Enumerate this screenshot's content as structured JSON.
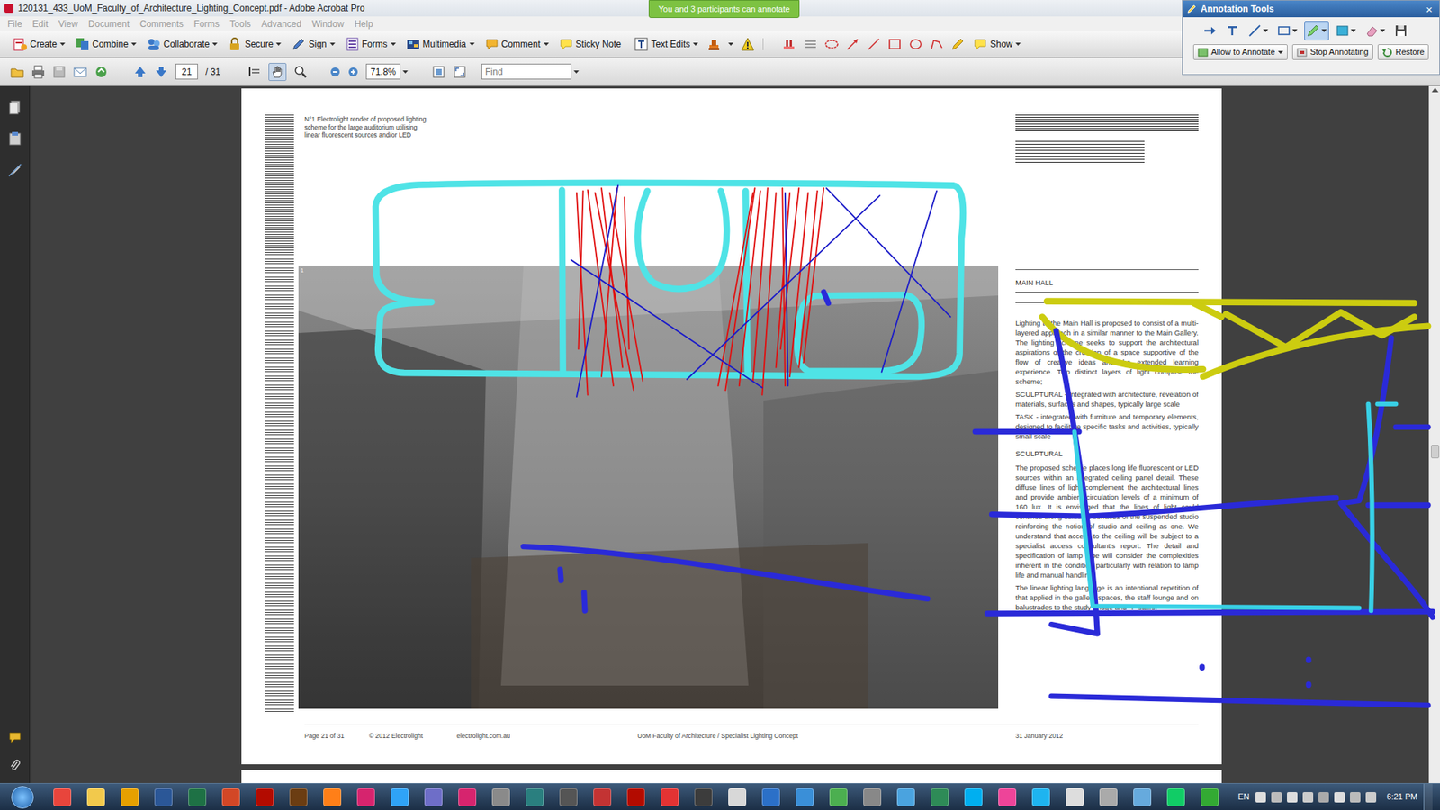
{
  "window": {
    "title": "120131_433_UoM_Faculty_of_Architecture_Lighting_Concept.pdf - Adobe Acrobat Pro"
  },
  "banner": {
    "text": "You and 3 participants can annotate"
  },
  "menu": [
    {
      "label": "File",
      "disabled": true
    },
    {
      "label": "Edit",
      "disabled": true
    },
    {
      "label": "View",
      "disabled": true
    },
    {
      "label": "Document",
      "disabled": true
    },
    {
      "label": "Comments",
      "disabled": true
    },
    {
      "label": "Forms",
      "disabled": true
    },
    {
      "label": "Tools",
      "disabled": true
    },
    {
      "label": "Advanced",
      "disabled": true
    },
    {
      "label": "Window",
      "disabled": true
    },
    {
      "label": "Help",
      "disabled": true
    }
  ],
  "toolbar": [
    {
      "label": "Create",
      "dropdown": true
    },
    {
      "label": "Combine",
      "dropdown": true
    },
    {
      "label": "Collaborate",
      "dropdown": true
    },
    {
      "label": "Secure",
      "dropdown": true
    },
    {
      "label": "Sign",
      "dropdown": true
    },
    {
      "label": "Forms",
      "dropdown": true
    },
    {
      "label": "Multimedia",
      "dropdown": true
    },
    {
      "label": "Comment",
      "dropdown": true
    },
    {
      "label": "Sticky Note",
      "dropdown": false
    },
    {
      "label": "Text Edits",
      "dropdown": true
    }
  ],
  "toolbar_show": {
    "label": "Show",
    "dropdown": true
  },
  "navigation": {
    "page": "21",
    "page_count": "/ 31",
    "zoom": "71.8%",
    "find_placeholder": "Find"
  },
  "annotation_tools": {
    "title": "Annotation Tools",
    "close": "×",
    "tools": [
      {
        "selected": false
      },
      {
        "selected": false
      },
      {
        "selected": false
      },
      {
        "selected": false
      },
      {
        "selected": true
      },
      {
        "selected": false
      },
      {
        "selected": false
      },
      {
        "selected": false
      }
    ],
    "buttons": [
      "Allow to Annotate",
      "Stop Annotating",
      "Restore"
    ]
  },
  "document": {
    "caption": "N°1 Electrolight render of proposed lighting scheme for the large auditorium utilising linear fluorescent sources and/or LED",
    "photo_number": "1",
    "section_title": "MAIN HALL",
    "blocks": [
      {
        "kind": "body",
        "text": "Lighting to the Main Hall is proposed to consist of a multi-layered approach in a similar manner to the Main Gallery. The lighting scheme seeks to support the architectural aspirations of the creation of a space supportive of the flow of creative ideas and the extended learning experience. Two distinct layers of light compose the scheme;"
      },
      {
        "kind": "body",
        "text": "SCULPTURAL - Integrated with architecture, revelation of materials, surfaces and shapes, typically large scale"
      },
      {
        "kind": "body",
        "text": "TASK - integrated with furniture and temporary elements, designed to facilitate specific tasks and activities, typically small scale"
      },
      {
        "kind": "heading",
        "text": "SCULPTURAL"
      },
      {
        "kind": "body",
        "text": "The proposed scheme places long life fluorescent or LED sources within an integrated ceiling panel detail. These diffuse lines of light complement the architectural lines and provide ambient circulation levels of a minimum of 160 lux.  It is envisaged that the lines of light could continue along selected surfaces of the suspended studio reinforcing the notion of studio and ceiling as one.  We understand that access to the ceiling will be subject to a specialist access consultant's report.  The detail and specification of lamp type will consider the complexities inherent in the condition particularly with relation to lamp life and manual handling."
      },
      {
        "kind": "body",
        "text": "The linear lighting language is an intentional repetition of that applied in the gallery spaces, the staff lounge and on balustrades to the study bridge and 'Y' stairs."
      }
    ],
    "footer": [
      "Page 21 of 31",
      "© 2012 Electrolight",
      "electrolight.com.au",
      "UoM Faculty of Architecture / Specialist Lighting Concept",
      "31 January 2012"
    ]
  },
  "annotations": [
    {
      "kind": "pencil",
      "color": "#4fe3e6"
    },
    {
      "kind": "line",
      "color": "#e01010"
    },
    {
      "kind": "line",
      "color": "#1c1cc8"
    },
    {
      "kind": "pencil",
      "color": "#cccc10"
    },
    {
      "kind": "pencil",
      "color": "#2a2ad8"
    },
    {
      "kind": "pencil",
      "color": "#38d0e6"
    }
  ],
  "taskbar": {
    "apps": [
      {
        "color": "#e8453c"
      },
      {
        "color": "#f2c94c"
      },
      {
        "color": "#e6a000"
      },
      {
        "color": "#2b5797"
      },
      {
        "color": "#1e7145"
      },
      {
        "color": "#d24726"
      },
      {
        "color": "#b30b00"
      },
      {
        "color": "#6b3d12"
      },
      {
        "color": "#ff7f18"
      },
      {
        "color": "#d6246e"
      },
      {
        "color": "#2fa3f7"
      },
      {
        "color": "#6e6ec8"
      },
      {
        "color": "#d6246e"
      },
      {
        "color": "#8a8a8a"
      },
      {
        "color": "#2a7f7f"
      },
      {
        "color": "#555555"
      },
      {
        "color": "#c33333"
      },
      {
        "color": "#b30b00"
      },
      {
        "color": "#e33333"
      },
      {
        "color": "#3c3c3c"
      },
      {
        "color": "#d8d8d8"
      },
      {
        "color": "#2b70c8"
      },
      {
        "color": "#3a8fd8"
      },
      {
        "color": "#4caf50"
      },
      {
        "color": "#888888"
      },
      {
        "color": "#4aa3df"
      },
      {
        "color": "#2e8b57"
      },
      {
        "color": "#00aff0"
      },
      {
        "color": "#ee4499"
      },
      {
        "color": "#1eb4f0"
      },
      {
        "color": "#dddddd"
      },
      {
        "color": "#aaaaaa"
      },
      {
        "color": "#66aadd"
      },
      {
        "color": "#11cc66"
      },
      {
        "color": "#33aa33"
      }
    ],
    "language": "EN",
    "clock": "6:21 PM"
  }
}
